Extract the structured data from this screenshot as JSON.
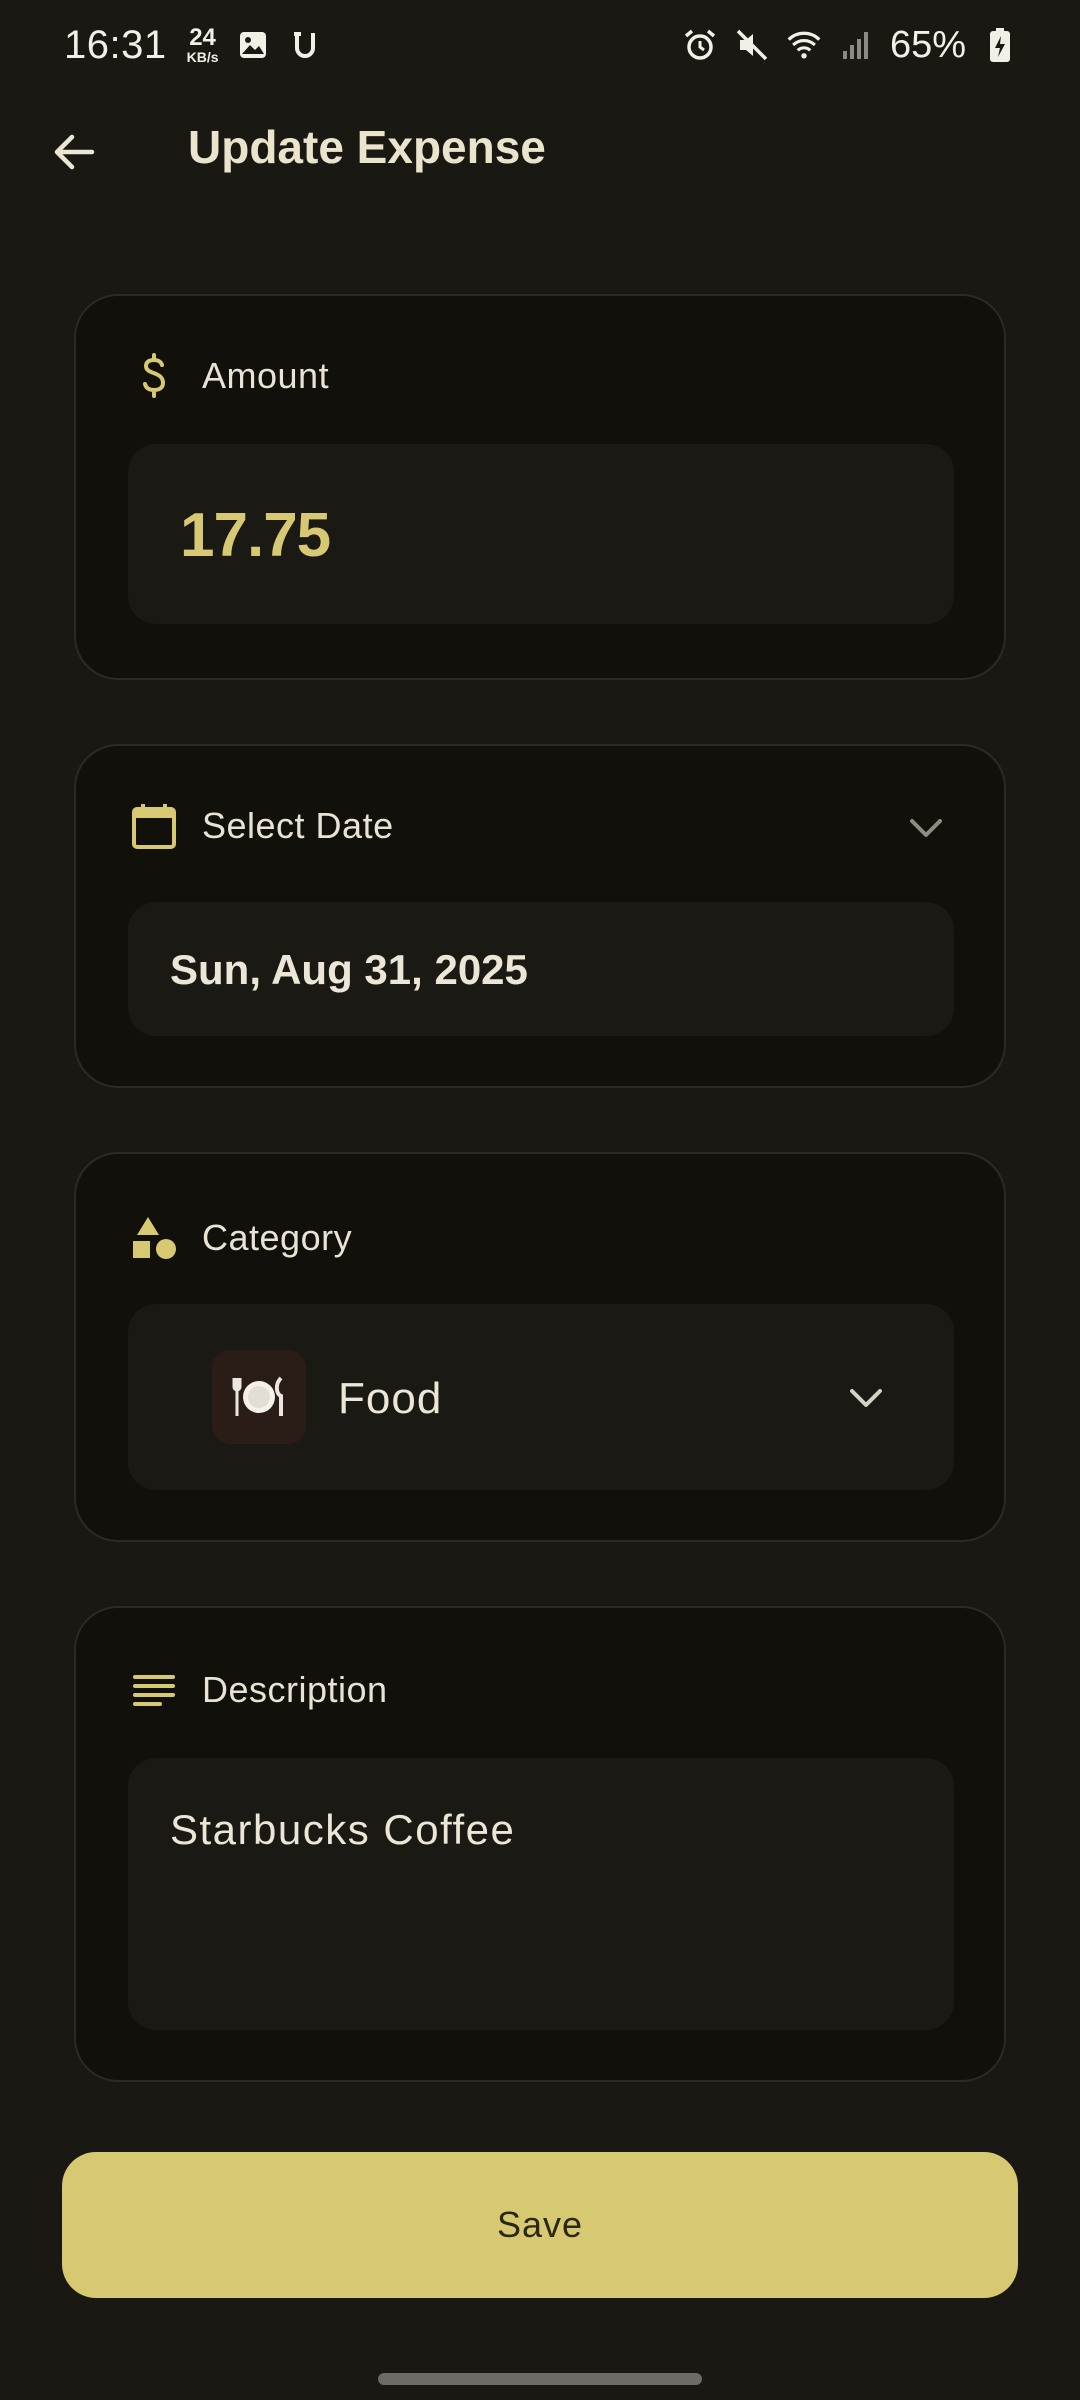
{
  "status_bar": {
    "time": "16:31",
    "net_speed_value": "24",
    "net_speed_unit": "KB/s",
    "battery": "65%",
    "icons": [
      "gallery-icon",
      "u-app-icon",
      "alarm-icon",
      "mute-icon",
      "wifi-icon",
      "signal-icon",
      "battery-charging-icon"
    ]
  },
  "header": {
    "back_icon": "arrow-left-icon",
    "title": "Update Expense"
  },
  "amount": {
    "label": "Amount",
    "icon": "dollar-icon",
    "value": "17.75"
  },
  "date": {
    "label": "Select Date",
    "icon": "calendar-icon",
    "value": "Sun, Aug 31, 2025"
  },
  "category": {
    "label": "Category",
    "icon": "shapes-icon",
    "selected_label": "Food",
    "selected_icon": "🍽️"
  },
  "description": {
    "label": "Description",
    "icon": "notes-lines-icon",
    "value": "Starbucks Coffee"
  },
  "actions": {
    "save_label": "Save"
  },
  "colors": {
    "background": "#1a1813",
    "card": "#12100b",
    "field": "#1b1914",
    "accent": "#d7c872",
    "text": "#ebe6d6"
  }
}
